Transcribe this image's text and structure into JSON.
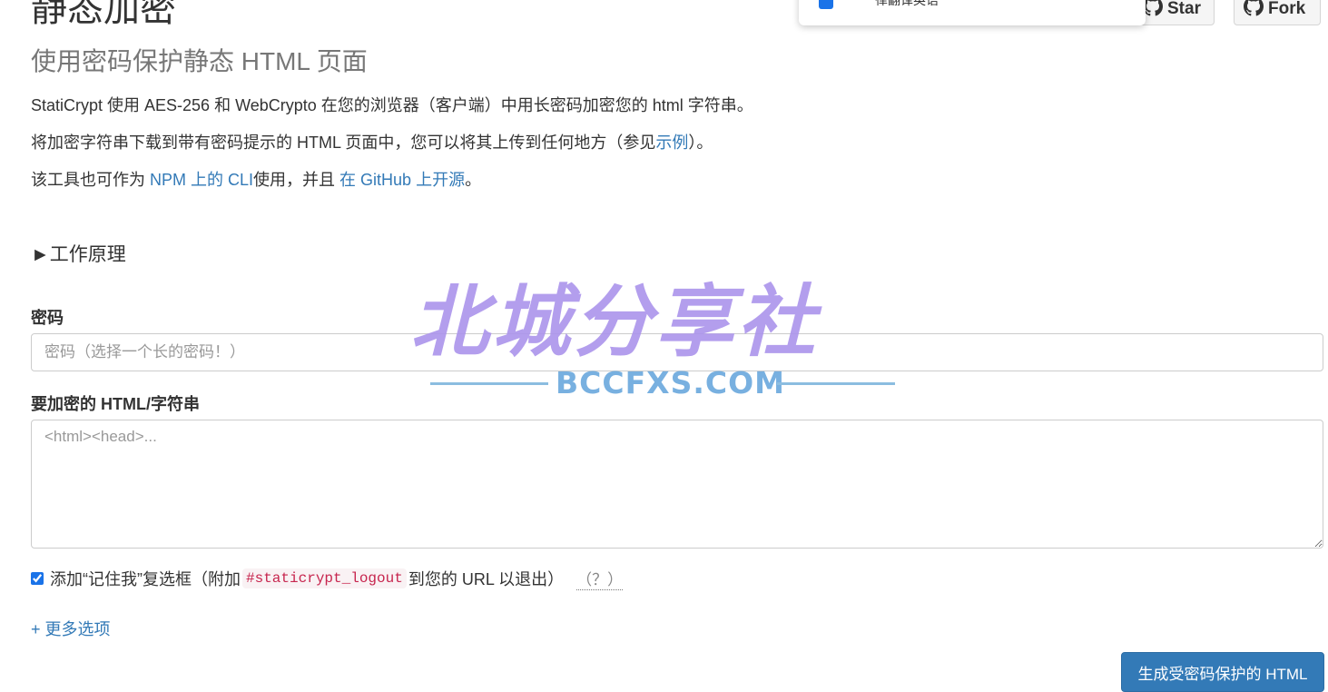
{
  "header": {
    "title": "静态加密",
    "subtitle": "使用密码保护静态 HTML 页面"
  },
  "intro": {
    "line1": "StatiCrypt 使用 AES-256 和 WebCrypto 在您的浏览器（客户端）中用长密码加密您的 html 字符串。",
    "line2_prefix": "将加密字符串下载到带有密码提示的 HTML 页面中，您可以将其上传到任何地方（参见",
    "line2_link": "示例",
    "line2_suffix": "）。",
    "line3_prefix": "该工具也可作为 ",
    "line3_link1": "NPM 上的 CLI",
    "line3_middle": "使用，并且 ",
    "line3_link2": "在 GitHub 上开源",
    "line3_suffix": "。"
  },
  "how_it_works": {
    "label": "►工作原理"
  },
  "form": {
    "password_label": "密码",
    "password_placeholder": "密码（选择一个长的密码！）",
    "html_label": "要加密的 HTML/字符串",
    "html_placeholder": "<html><head>...",
    "remember_prefix": "添加“记住我”复选框（附加",
    "remember_code": "#staticrypt_logout",
    "remember_suffix": "到您的 URL 以退出）",
    "remember_checked": true,
    "remember_help": "（？）",
    "more_options": "+ 更多选项",
    "generate_button": "生成受密码保护的 HTML"
  },
  "github": {
    "star_label": "Star",
    "fork_label": "Fork"
  },
  "translate_popup": {
    "text": "一律翻译英语",
    "checked": true
  },
  "watermark": {
    "main": "北城分享社",
    "sub": "BCCFXS.COM"
  },
  "colors": {
    "link": "#337ab7",
    "primary_button": "#337ab7",
    "code_text": "#c7254e",
    "code_bg": "#f9f2f4"
  }
}
